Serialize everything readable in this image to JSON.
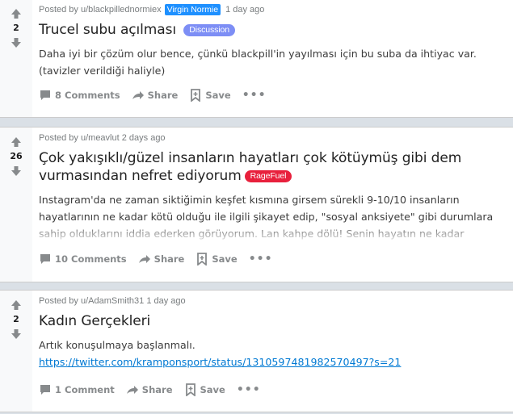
{
  "posts": [
    {
      "score": "2",
      "posted_by": "Posted by u/blackpillednormiex",
      "user_flair": "Virgin Normie",
      "age": "1 day ago",
      "title": "Trucel subu açılması",
      "tag": "Discussion",
      "body_lines": [
        "Daha iyi bir çözüm olur bence, çünkü blackpill'in yayılması için bu suba da ihtiyac var.",
        "(tavizler verildiği haliyle)"
      ],
      "comments": "8 Comments",
      "share": "Share",
      "save": "Save",
      "more": "•••"
    },
    {
      "score": "26",
      "posted_by": "Posted by u/meavlut",
      "age": "2 days ago",
      "title_line1": "Çok yakışıklı/güzel insanların hayatları çok kötüymüş gibi dem",
      "title_line2": "vurmasından nefret ediyorum",
      "tag": "RageFuel",
      "body_lines": [
        "Instagram'da ne zaman siktiğimin keşfet kısmına girsem sürekli 9-10/10 insanların",
        "hayatlarının ne kadar kötü olduğu ile ilgili şikayet edip, \"sosyal anksiyete\" gibi durumlara",
        "sahip olduklarını iddia ederken görüyorum. Lan kahpe dölü! Senin hayatın ne kadar"
      ],
      "comments": "10 Comments",
      "share": "Share",
      "save": "Save",
      "more": "•••"
    },
    {
      "score": "2",
      "posted_by": "Posted by u/AdamSmith31",
      "age": "1 day ago",
      "title": "Kadın Gerçekleri",
      "body_line": "Artık konuşulmaya başlanmalı.",
      "link": "https://twitter.com/kramponsport/status/1310597481982570497?s=21",
      "comments": "1 Comment",
      "share": "Share",
      "save": "Save",
      "more": "•••"
    }
  ]
}
